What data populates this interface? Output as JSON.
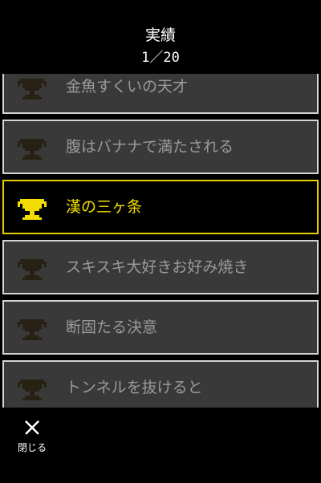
{
  "header": {
    "title": "実績",
    "progress": "1／20"
  },
  "achievements": [
    {
      "name": "金魚すくいの天才",
      "unlocked": false,
      "selected": false
    },
    {
      "name": "腹はバナナで満たされる",
      "unlocked": false,
      "selected": false
    },
    {
      "name": "漢の三ヶ条",
      "unlocked": true,
      "selected": true
    },
    {
      "name": "スキスキ大好きお好み焼き",
      "unlocked": false,
      "selected": false
    },
    {
      "name": "断固たる決意",
      "unlocked": false,
      "selected": false
    },
    {
      "name": "トンネルを抜けると",
      "unlocked": false,
      "selected": false
    }
  ],
  "footer": {
    "close_label": "閉じる",
    "close_icon": "close-icon"
  },
  "colors": {
    "background": "#000000",
    "item_background": "#393939",
    "item_border": "#d4d4d4",
    "item_text": "#9a9a9a",
    "selected_border": "#e6d000",
    "selected_text": "#f4e000",
    "trophy_locked": "#262113",
    "trophy_unlocked": "#f2dc00"
  }
}
